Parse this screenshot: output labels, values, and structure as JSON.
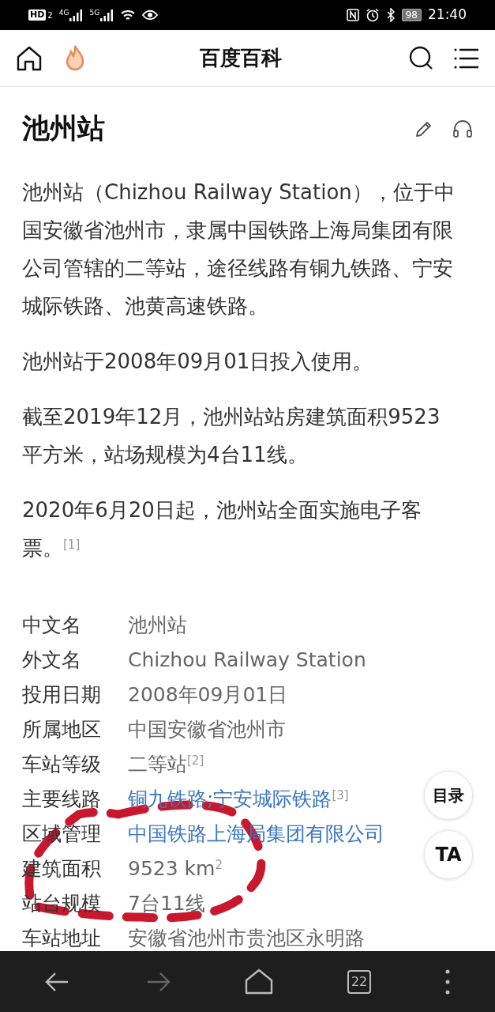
{
  "status_bar": {
    "hd": "HD",
    "sim": "2",
    "net1": "4G",
    "net2": "5G",
    "battery": "98",
    "time": "21:40"
  },
  "header": {
    "title": "百度百科"
  },
  "article": {
    "title": "池州站",
    "paragraphs": [
      "池州站（Chizhou Railway Station），位于中国安徽省池州市，隶属中国铁路上海局集团有限公司管辖的二等站，途径线路有铜九铁路、宁安城际铁路、池黄高速铁路。",
      "池州站于2008年09月01日投入使用。",
      "截至2019年12月，池州站站房建筑面积9523平方米，站场规模为4台11线。",
      "2020年6月20日起，池州站全面实施电子客票。$^{[1]}$"
    ],
    "infobox": [
      {
        "label": "中文名",
        "value": "池州站",
        "kind": "text"
      },
      {
        "label": "外文名",
        "value": "Chizhou Railway Station",
        "kind": "text"
      },
      {
        "label": "投用日期",
        "value": "2008年09月01日",
        "kind": "text"
      },
      {
        "label": "所属地区",
        "value": "中国安徽省池州市",
        "kind": "text"
      },
      {
        "label": "车站等级",
        "value": "二等站$^{[2]}$",
        "kind": "text"
      },
      {
        "label": "主要线路",
        "value": "铜九铁路;宁安城际铁路$^{[3]}$",
        "kind": "link"
      },
      {
        "label": "区域管理",
        "value": "中国铁路上海局集团有限公司",
        "kind": "link"
      },
      {
        "label": "建筑面积",
        "value": "9523 km$^{2}$",
        "kind": "text"
      },
      {
        "label": "站台规模",
        "value": "7台11线",
        "kind": "text"
      },
      {
        "label": "车站地址",
        "value": "安徽省池州市贵池区永明路",
        "kind": "text"
      }
    ]
  },
  "floating_buttons": [
    {
      "label": "目录",
      "kind": "toc"
    },
    {
      "label": "TA",
      "kind": "ta"
    }
  ],
  "bottom_bar": [
    {
      "kind": "back",
      "disabled": false
    },
    {
      "kind": "forward",
      "disabled": true
    },
    {
      "kind": "home",
      "disabled": false
    },
    {
      "kind": "tabs",
      "label": "22",
      "disabled": false
    },
    {
      "kind": "more",
      "disabled": false
    }
  ]
}
